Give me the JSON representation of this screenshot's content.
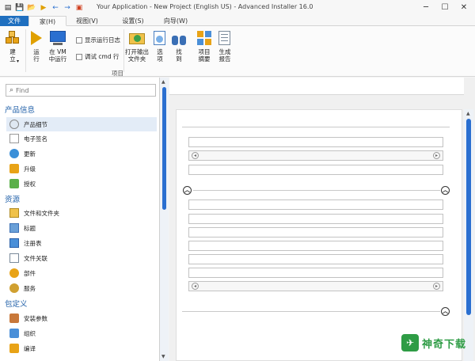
{
  "window": {
    "title": "Your Application - New Project (English US) - Advanced Installer 16.0",
    "min": "─",
    "max": "☐",
    "close": "✕"
  },
  "qat": [
    "▤",
    "💾",
    "📂",
    "▶",
    "←",
    "→",
    "▣"
  ],
  "ribbon_tabs": [
    "文件",
    "家(H)",
    "视图(V)",
    "设置(S)",
    "向导(W)"
  ],
  "ribbon": {
    "build": "建\n立",
    "build_arrow": "▾",
    "run": "运\n行",
    "run_vm": "在 VM\n中运行",
    "show_log": "显示运行日志",
    "debug_cmd": "调试 cmd 行",
    "open_output": "打开输出\n文件夹",
    "options": "选\n项",
    "find": "找\n到",
    "project_summary": "项目\n摘要",
    "generate_report": "生成\n报告",
    "group_label": "项目"
  },
  "search": {
    "placeholder": "Find"
  },
  "nav": {
    "sections": [
      {
        "title": "产品信息",
        "items": [
          "产品细节",
          "电子签名",
          "更新",
          "升级",
          "授权"
        ]
      },
      {
        "title": "资源",
        "items": [
          "文件和文件夹",
          "标题",
          "注册表",
          "文件关联",
          "部件",
          "服务"
        ]
      },
      {
        "title": "包定义",
        "items": [
          "安装参数",
          "组织",
          "编译"
        ]
      }
    ]
  },
  "watermark": {
    "logo": "✈",
    "text": "神奇下载"
  },
  "colors": {
    "accent": "#1f6fbf",
    "section": "#1f5fa8",
    "scroll": "#2a6fd0",
    "watermark": "#2e9c45"
  }
}
